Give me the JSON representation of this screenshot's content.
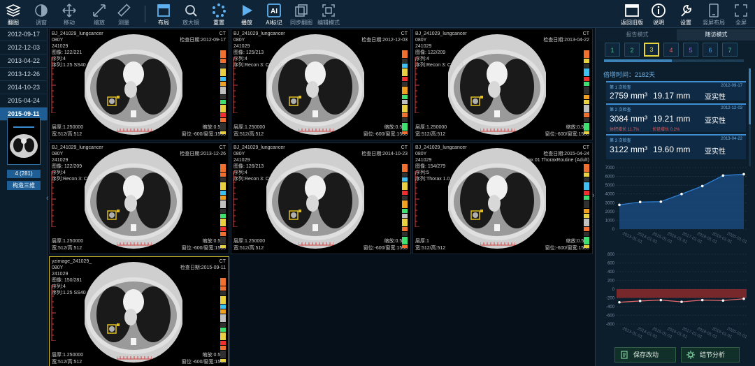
{
  "toolbar": {
    "left": [
      {
        "label": "翻图",
        "icon": "layers-icon"
      },
      {
        "label": "调窗",
        "icon": "contrast-icon"
      },
      {
        "label": "移动",
        "icon": "move-icon"
      },
      {
        "label": "缩放",
        "icon": "zoom-icon"
      },
      {
        "label": "测量",
        "icon": "ruler-icon"
      },
      {
        "label": "布局",
        "icon": "layout-icon"
      },
      {
        "label": "放大镜",
        "icon": "magnifier-icon"
      },
      {
        "label": "重置",
        "icon": "reset-icon"
      },
      {
        "label": "播放",
        "icon": "play-icon"
      },
      {
        "label": "AI标记",
        "icon": "ai-icon"
      },
      {
        "label": "同步翻图",
        "icon": "sync-icon"
      },
      {
        "label": "编辑模式",
        "icon": "edit-mode-icon"
      }
    ],
    "right": [
      {
        "label": "返回旧版",
        "icon": "window-icon"
      },
      {
        "label": "说明",
        "icon": "info-icon"
      },
      {
        "label": "设置",
        "icon": "wrench-icon"
      },
      {
        "label": "竖屏布局",
        "icon": "portrait-icon"
      },
      {
        "label": "全屏",
        "icon": "fullscreen-icon"
      }
    ]
  },
  "dates": [
    "2012-09-17",
    "2012-12-03",
    "2013-04-22",
    "2013-12-26",
    "2014-10-23",
    "2015-04-24",
    "2015-09-11"
  ],
  "selected_date": "2015-09-11",
  "thumbnail": {
    "label": "4 (281)",
    "button": "构造三维"
  },
  "viewports": [
    {
      "tl1": "BJ_241029_lungcancer",
      "tl2": "080Y",
      "tl3": "241029",
      "tl4": "图像: 122/221",
      "tl5": "序列:4",
      "tl6": "序列:1.25 SS40",
      "modality": "CT",
      "date": "检查日期:2012-09-17",
      "bl1": "层厚:1.250000",
      "bl2": "宽:512/高:512",
      "br1": "缩放:0.529",
      "br2": "窗位:-600/窗宽:1500"
    },
    {
      "tl1": "BJ_241029_lungcancer",
      "tl2": "080Y",
      "tl3": "241029",
      "tl4": "图像: 125/213",
      "tl5": "序列:4",
      "tl6": "序列:Recon 3: CHEST",
      "modality": "CT",
      "date": "检查日期:2012-12-03",
      "bl1": "层厚:1.250000",
      "bl2": "宽:512/高:512",
      "br1": "缩放:0.529",
      "br2": "窗位:-600/窗宽:1500"
    },
    {
      "tl1": "BJ_241029_lungcancer",
      "tl2": "080Y",
      "tl3": "241029",
      "tl4": "图像: 122/209",
      "tl5": "序列:4",
      "tl6": "序列:Recon 3: CHEST",
      "modality": "CT",
      "date": "检查日期:2013-04-22",
      "bl1": "层厚:1.250000",
      "bl2": "宽:512/高:512",
      "br1": "缩放:0.529",
      "br2": "窗位:-600/窗宽:1500"
    },
    {
      "tl1": "BJ_241029_lungcancer",
      "tl2": "080Y",
      "tl3": "241029",
      "tl4": "图像: 122/209",
      "tl5": "序列:4",
      "tl6": "序列:Recon 3: CHEST",
      "modality": "CT",
      "date": "检查日期:2013-12-26",
      "bl1": "层厚:1.250000",
      "bl2": "宽:512/高:512",
      "br1": "缩放:0.531",
      "br2": "窗位:-600/窗宽:1500"
    },
    {
      "tl1": "BJ_241029_lungcancer",
      "tl2": "080Y",
      "tl3": "241029",
      "tl4": "图像: 126/213",
      "tl5": "序列:4",
      "tl6": "序列:Recon 3: CHEST",
      "modality": "CT",
      "date": "检查日期:2014-10-23",
      "bl1": "层厚:1.250000",
      "bl2": "宽:512/高:512",
      "br1": "缩放:0.531",
      "br2": "窗位:-600/窗宽:1500"
    },
    {
      "tl1": "BJ_241029_lungcancer",
      "tl2": "080Y",
      "tl3": "241029",
      "tl4": "图像: 154/279",
      "tl5": "序列:5",
      "tl6": "序列:Thorax 1.0 B31f",
      "modality": "CT",
      "date": "检查日期:2015-04-24",
      "date2": "Thorax 01 ThoraxRoutine (Adult)",
      "bl1": "层厚:1",
      "bl2": "宽:512/高:512",
      "br1": "缩放:0.531",
      "br2": "窗位:-600/窗宽:1500"
    },
    {
      "tl1": "yzimage_241029_",
      "tl2": "080Y",
      "tl3": "241029",
      "tl4": "图像: 150/281",
      "tl5": "序列:4",
      "tl6": "序列:1.25 SS40",
      "modality": "CT",
      "date": "检查日期:2015-09-11",
      "bl1": "层厚:1.250000",
      "bl2": "宽:512/高:512",
      "br1": "缩放:0.531",
      "br2": "窗位:-600/窗宽:1500"
    }
  ],
  "right_panel": {
    "tabs": [
      "报告模式",
      "随访模式"
    ],
    "active_tab": "随访模式",
    "numbers": [
      "1",
      "2",
      "3",
      "4",
      "5",
      "6",
      "7"
    ],
    "selected_number": "3",
    "interval": "倍增时间：2182天",
    "cards": [
      {
        "title": "第 1 次检查",
        "date": "2012-09-17",
        "volume": "2759 mm³",
        "diameter": "19.17 mm",
        "type": "亚实性",
        "change1": "",
        "change2": ""
      },
      {
        "title": "第 2 次检查",
        "date": "2012-12-03",
        "volume": "3084 mm³",
        "diameter": "19.21 mm",
        "type": "亚实性",
        "change1": "体积增长 11.7%",
        "change2": "长径增长 0.2%"
      },
      {
        "title": "第 3 次检查",
        "date": "2013-04-22",
        "volume": "3122 mm³",
        "diameter": "19.60 mm",
        "type": "亚实性",
        "change1": "",
        "change2": ""
      }
    ],
    "buttons": {
      "save": "保存改动",
      "analysis": "结节分析"
    }
  },
  "chart_data": [
    {
      "type": "area",
      "x": [
        "2012-09-17",
        "2012-12-03",
        "2013-04-22",
        "2013-12-26",
        "2014-10-23",
        "2015-04-24",
        "2015-09-11"
      ],
      "series": [
        {
          "values": [
            2759,
            3084,
            3122,
            4000,
            4900,
            6100,
            6250
          ]
        }
      ],
      "ylim": [
        0,
        7000
      ],
      "yticks": [
        "0",
        "1000",
        "2000",
        "3000",
        "4000",
        "5000",
        "6000",
        "7000"
      ],
      "xticks": [
        "2013-01-01",
        "2014-01-01",
        "2015-01-01",
        "2016-01-01",
        "2017-01-01",
        "2018-01-01",
        "2019-01-01",
        "2020-01-01"
      ],
      "grid": true,
      "colors": {
        "line": "#2f7fd0",
        "fill": "#1b4f86"
      }
    },
    {
      "type": "line",
      "x": [
        "2012-09-17",
        "2012-12-03",
        "2013-04-22",
        "2013-12-26",
        "2014-10-23",
        "2015-04-24",
        "2015-09-11"
      ],
      "series": [
        {
          "values": [
            -300,
            -270,
            -250,
            -290,
            -250,
            -260,
            -220
          ]
        }
      ],
      "ylim": [
        -800,
        800
      ],
      "yticks": [
        "-800",
        "-600",
        "-400",
        "-200",
        "0",
        "200",
        "400",
        "600",
        "800"
      ],
      "xticks": [
        "2013-01-01",
        "2014-01-01",
        "2015-01-01",
        "2016-01-01",
        "2017-01-01",
        "2018-01-01",
        "2019-01-01",
        "2020-01-01"
      ],
      "band": [
        0,
        -200
      ],
      "grid": true,
      "colors": {
        "line": "#e86a6a",
        "band": "#8a2a2a"
      }
    }
  ]
}
